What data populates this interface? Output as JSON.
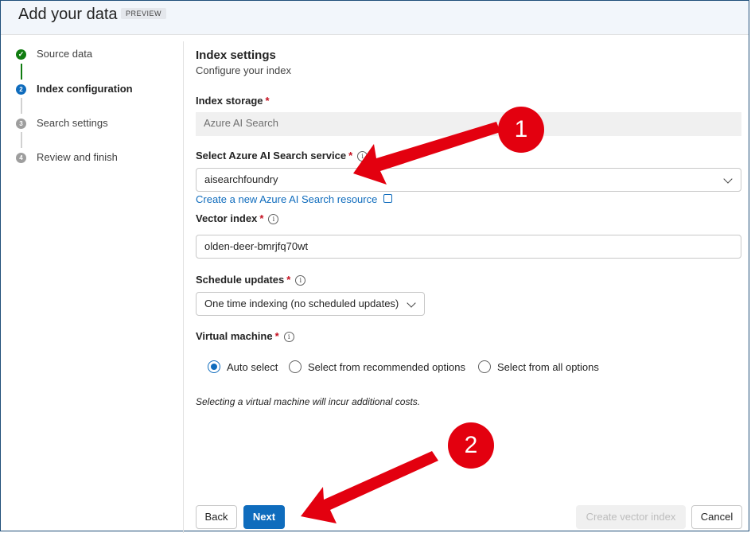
{
  "header": {
    "title": "Add your data",
    "badge": "PREVIEW"
  },
  "steps": [
    {
      "number": "✓",
      "label": "Source data",
      "state": "complete"
    },
    {
      "number": "2",
      "label": "Index configuration",
      "state": "current"
    },
    {
      "number": "3",
      "label": "Search settings",
      "state": "pending"
    },
    {
      "number": "4",
      "label": "Review and finish",
      "state": "pending"
    }
  ],
  "form": {
    "title": "Index settings",
    "subtitle": "Configure your index",
    "index_storage": {
      "label": "Index storage",
      "required": "*",
      "value": "Azure AI Search"
    },
    "search_service": {
      "label": "Select Azure AI Search service",
      "required": "*",
      "value": "aisearchfoundry"
    },
    "create_link": "Create a new Azure AI Search resource",
    "vector_index": {
      "label": "Vector index",
      "required": "*",
      "value": "olden-deer-bmrjfq70wt"
    },
    "schedule": {
      "label": "Schedule updates",
      "required": "*",
      "value": "One time indexing (no scheduled updates)"
    },
    "vm": {
      "label": "Virtual machine",
      "required": "*",
      "options": [
        "Auto select",
        "Select from recommended options",
        "Select from all options"
      ],
      "selected": "Auto select"
    },
    "note": "Selecting a virtual machine will incur additional costs."
  },
  "footer": {
    "back": "Back",
    "next": "Next",
    "create": "Create vector index",
    "cancel": "Cancel"
  },
  "annotations": {
    "callout1": "1",
    "callout2": "2"
  },
  "colors": {
    "accent": "#0f6cbd",
    "complete": "#107c10",
    "callout": "#e3000f",
    "required": "#c50f1f"
  },
  "icons": {
    "info": "info-icon",
    "external": "external-link-icon",
    "chevron": "chevron-down-icon"
  }
}
